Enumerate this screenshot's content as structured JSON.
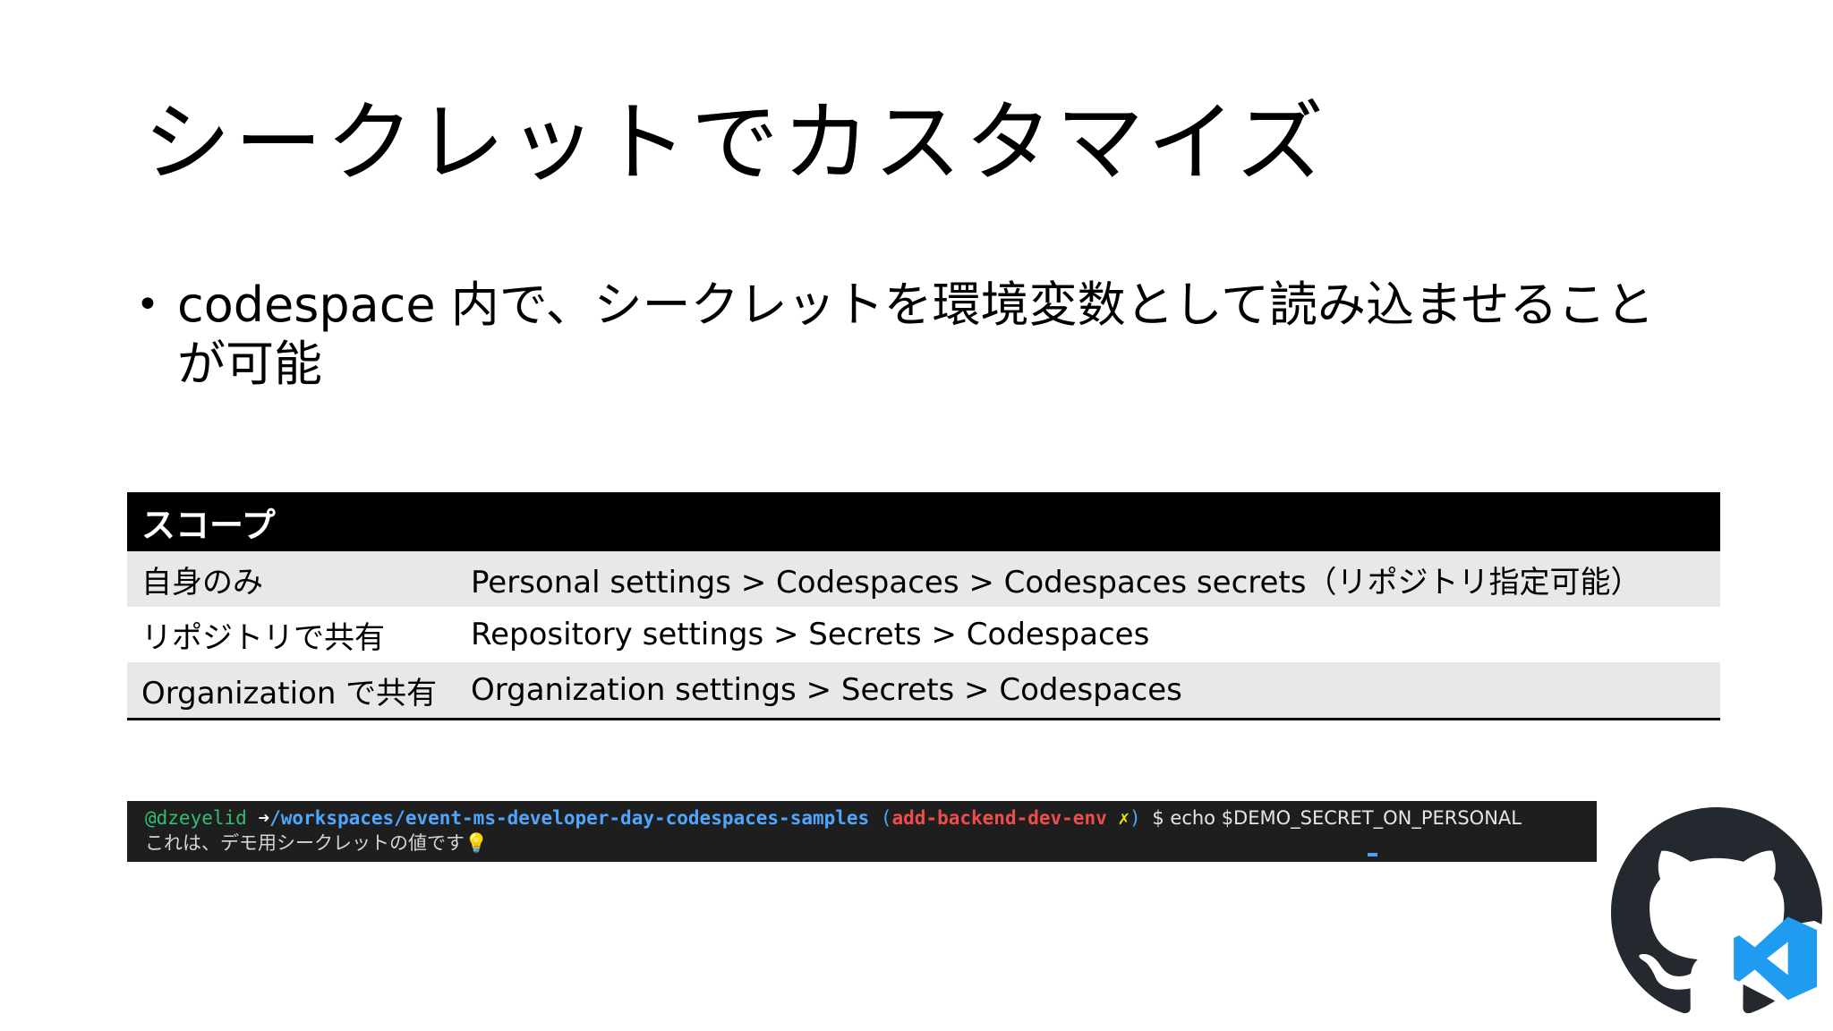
{
  "slide": {
    "title": "シークレットでカスタマイズ",
    "bullet_marker": "•",
    "bullet_text": "codespace 内で、シークレットを環境変数として読み込ませることが可能"
  },
  "scope_table": {
    "header": "スコープ",
    "rows": [
      {
        "scope": "自身のみ",
        "path": "Personal settings > Codespaces > Codespaces secrets（リポジトリ指定可能）"
      },
      {
        "scope": "リポジトリで共有",
        "path": "Repository settings > Secrets > Codespaces"
      },
      {
        "scope": "Organization で共有",
        "path": "Organization settings > Secrets > Codespaces"
      }
    ]
  },
  "terminal": {
    "user": "@dzeyelid",
    "arrow": "➜",
    "path": "/workspaces/event-ms-developer-day-codespaces-samples",
    "branch_open": "(",
    "branch": "add-backend-dev-env",
    "dirty_marker": "✗",
    "branch_close": ")",
    "command": "$ echo $DEMO_SECRET_ON_PERSONAL",
    "output": "これは、デモ用シークレットの値です💡"
  },
  "logos": {
    "github": "github-octocat-icon",
    "vscode": "vscode-icon",
    "github_color": "#24292f",
    "vscode_color": "#1f9cf0"
  }
}
